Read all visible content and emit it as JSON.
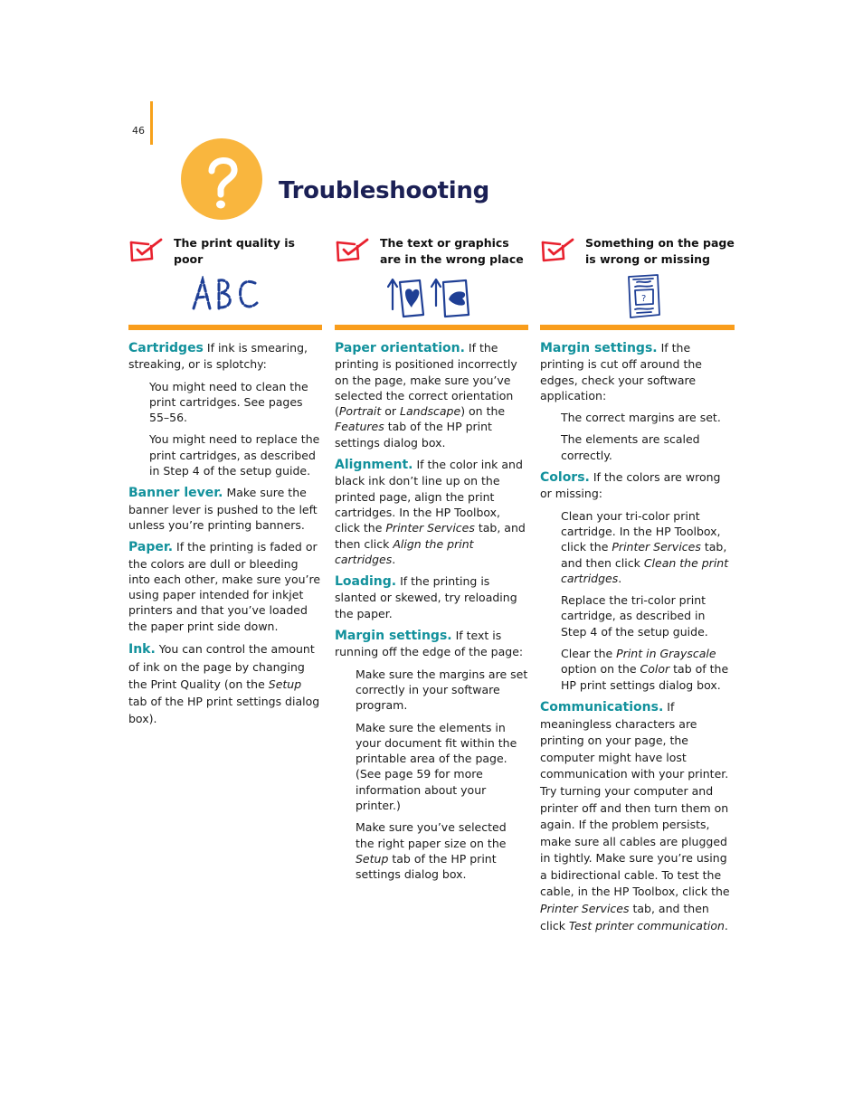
{
  "page": {
    "number": "46",
    "title": "Troubleshooting",
    "colors": {
      "accent_orange": "#f99d1c",
      "badge_yellow": "#f9b63e",
      "title_navy": "#1b2055",
      "heading_teal": "#12919c",
      "check_red": "#e8212e",
      "sketch_blue": "#1f3f95"
    }
  },
  "columns": [
    {
      "heading": "The print quality is poor",
      "check_icon": "red-checkbox-icon",
      "illustration": "faded-abc-icon",
      "illustration_text": "ABC",
      "sections": [
        {
          "lead": "Cartridges",
          "text": " If ink is smearing, streaking, or is splotchy:",
          "items": [
            "You might need to clean the print cartridges. See pages 55–56.",
            "You might need to replace the print cartridges, as described in Step 4 of the setup guide."
          ]
        },
        {
          "lead": "Banner lever.",
          "text": " Make sure the banner lever is pushed to the left unless you’re printing banners."
        },
        {
          "lead": "Paper.",
          "text": " If the printing is faded or the colors are dull or bleeding into each other, make sure you’re using paper intended for inkjet printers and that you’ve loaded the paper print side down."
        },
        {
          "lead": "Ink.",
          "text_before": " You can control the amount of ink on the page by changing the Print Quality (on the ",
          "italic": "Setup",
          "text_after": " tab of the HP print settings dialog box)."
        }
      ]
    },
    {
      "heading": "The text or graphics are in the wrong place",
      "check_icon": "red-checkbox-icon",
      "illustration": "page-orientation-icon",
      "sections": [
        {
          "lead": "Paper orientation.",
          "parts": [
            " If the printing is positioned incorrectly on the page, make sure you’ve selected the correct orientation (",
            "Portrait",
            " or ",
            "Landscape",
            ") on the ",
            "Features",
            " tab of the HP print settings dialog box."
          ]
        },
        {
          "lead": "Alignment.",
          "parts": [
            " If the color ink and black ink don’t line up on the printed page, align the print cartridges. In the HP Toolbox, click the ",
            "Printer Services",
            " tab, and then click ",
            "Align the print cartridges",
            "."
          ]
        },
        {
          "lead": "Loading.",
          "text": " If the printing is slanted or skewed, try reloading the paper."
        },
        {
          "lead": "Margin settings.",
          "text": " If text is running off the edge of the page:",
          "items": [
            "Make sure the margins are set correctly in your software program.",
            "Make sure the elements in your document fit within the printable area of the page. (See page 59 for more information about your printer.)"
          ],
          "last_item": {
            "before": "Make sure you’ve selected the right paper size on the ",
            "italic": "Setup",
            "after": " tab of the HP print settings dialog box."
          }
        }
      ]
    },
    {
      "heading": "Something on the page is wrong or missing",
      "check_icon": "red-checkbox-icon",
      "illustration": "page-missing-content-icon",
      "sections": [
        {
          "lead": "Margin settings.",
          "text": " If the printing is cut off around the edges, check your software application:",
          "items": [
            "The correct margins are set.",
            "The elements are scaled correctly."
          ]
        },
        {
          "lead": "Colors.",
          "text": " If the colors are wrong or missing:",
          "item_parts": [
            [
              "Clean your tri-color print cartridge. In the HP Toolbox, click the ",
              "Printer Services",
              " tab, and then click ",
              "Clean the print cartridges",
              "."
            ],
            [
              "Replace the tri-color print cartridge, as described in Step 4 of the setup guide."
            ],
            [
              "Clear the ",
              "Print in Grayscale",
              " option on the ",
              "Color",
              " tab of the HP print settings dialog box."
            ]
          ]
        },
        {
          "lead": "Communications.",
          "parts": [
            " If meaningless characters are printing on your page, the computer might have lost communication with your printer. Try turning your computer and printer off and then turn them on again. If the problem persists, make sure all cables are plugged in tightly. Make sure you’re using a bidirectional cable. To test the cable, in the HP Toolbox, click the ",
            "Printer Services",
            " tab, and then click ",
            "Test printer communication",
            "."
          ]
        }
      ]
    }
  ]
}
